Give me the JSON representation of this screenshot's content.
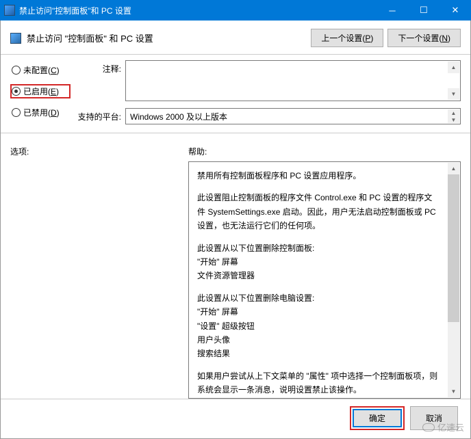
{
  "titlebar": {
    "title": "禁止访问\"控制面板\"和 PC 设置"
  },
  "header": {
    "title": "禁止访问 \"控制面板\" 和 PC 设置",
    "prev_btn_prefix": "上一个设置(",
    "prev_btn_key": "P",
    "prev_btn_suffix": ")",
    "next_btn_prefix": "下一个设置(",
    "next_btn_key": "N",
    "next_btn_suffix": ")"
  },
  "radios": {
    "not_configured_prefix": "未配置(",
    "not_configured_key": "C",
    "not_configured_suffix": ")",
    "enabled_prefix": "已启用(",
    "enabled_key": "E",
    "enabled_suffix": ")",
    "disabled_prefix": "已禁用(",
    "disabled_key": "D",
    "disabled_suffix": ")",
    "selected": "enabled"
  },
  "fields": {
    "comment_label": "注释:",
    "comment_value": "",
    "platform_label": "支持的平台:",
    "platform_value": "Windows 2000 及以上版本"
  },
  "sections": {
    "options_label": "选项:",
    "help_label": "帮助:"
  },
  "help": {
    "p1": "禁用所有控制面板程序和 PC 设置应用程序。",
    "p2": "此设置阻止控制面板的程序文件 Control.exe 和 PC 设置的程序文件 SystemSettings.exe 启动。因此，用户无法启动控制面板或 PC 设置，也无法运行它们的任何项。",
    "p3": "此设置从以下位置删除控制面板:",
    "p3a": "\"开始\" 屏幕",
    "p3b": "文件资源管理器",
    "p4": "此设置从以下位置删除电脑设置:",
    "p4a": "\"开始\" 屏幕",
    "p4b": "\"设置\" 超级按钮",
    "p4c": "用户头像",
    "p4d": "搜索结果",
    "p5": "如果用户尝试从上下文菜单的 \"属性\" 项中选择一个控制面板项，则系统会显示一条消息，说明设置禁止该操作。"
  },
  "footer": {
    "ok": "确定",
    "cancel": "取消"
  },
  "watermark": "亿速云"
}
